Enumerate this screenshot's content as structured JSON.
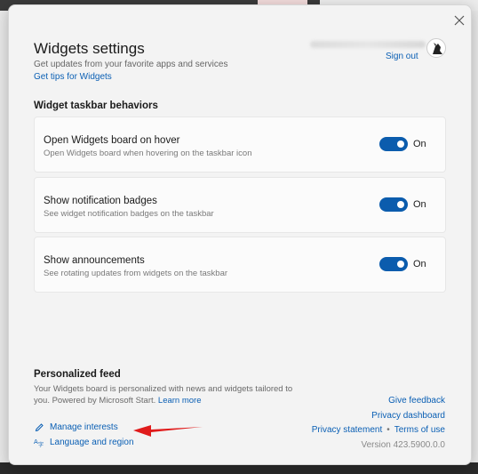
{
  "dialog": {
    "title": "Widgets settings",
    "subtitle": "Get updates from your favorite apps and services",
    "tips_link": "Get tips for Widgets",
    "close_icon": "close-icon",
    "account": {
      "sign_out": "Sign out"
    }
  },
  "taskbar_section": {
    "heading": "Widget taskbar behaviors",
    "items": [
      {
        "title": "Open Widgets board on hover",
        "description": "Open Widgets board when hovering on the taskbar icon",
        "state": "On"
      },
      {
        "title": "Show notification badges",
        "description": "See widget notification badges on the taskbar",
        "state": "On"
      },
      {
        "title": "Show announcements",
        "description": "See rotating updates from widgets on the taskbar",
        "state": "On"
      }
    ]
  },
  "feed": {
    "heading": "Personalized feed",
    "description": "Your Widgets board is personalized with news and widgets tailored to you. Powered by Microsoft Start.",
    "learn_more": "Learn more",
    "manage_interests": "Manage interests",
    "language_region": "Language and region"
  },
  "links": {
    "give_feedback": "Give feedback",
    "privacy_dashboard": "Privacy dashboard",
    "privacy_statement": "Privacy statement",
    "terms": "Terms of use",
    "version": "Version 423.5900.0.0"
  },
  "colors": {
    "accent": "#0b5cad",
    "link": "#0a5fb4",
    "annotation_arrow": "#e01b1b"
  }
}
